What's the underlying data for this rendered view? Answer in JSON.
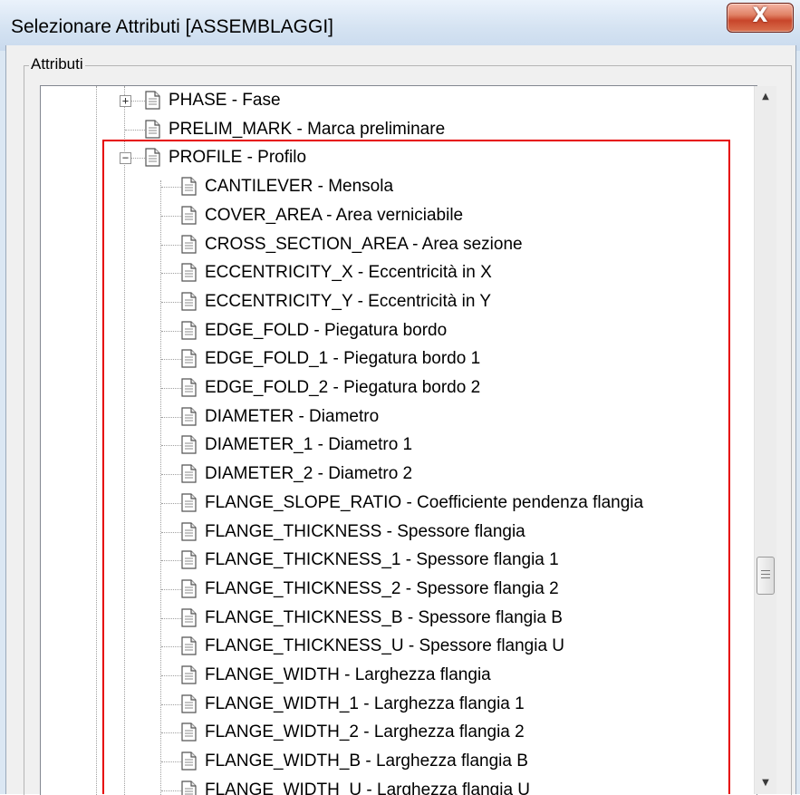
{
  "window": {
    "title": "Selezionare Attributi [ASSEMBLAGGI]",
    "close_icon": "X"
  },
  "group": {
    "label": "Attributi"
  },
  "tree": {
    "items": [
      {
        "text": "PHASE  -  Fase",
        "expander": "+"
      },
      {
        "text": "PRELIM_MARK  -  Marca preliminare",
        "expander": ""
      },
      {
        "text": "PROFILE  -  Profilo",
        "expander": "−"
      }
    ],
    "children": [
      {
        "text": "CANTILEVER  -  Mensola"
      },
      {
        "text": "COVER_AREA  -  Area verniciabile"
      },
      {
        "text": "CROSS_SECTION_AREA  -  Area sezione"
      },
      {
        "text": "ECCENTRICITY_X  -  Eccentricità in X"
      },
      {
        "text": "ECCENTRICITY_Y  -  Eccentricità in Y"
      },
      {
        "text": "EDGE_FOLD  -  Piegatura bordo"
      },
      {
        "text": "EDGE_FOLD_1  -  Piegatura bordo 1"
      },
      {
        "text": "EDGE_FOLD_2  -  Piegatura bordo 2"
      },
      {
        "text": "DIAMETER  -  Diametro"
      },
      {
        "text": "DIAMETER_1  -  Diametro 1"
      },
      {
        "text": "DIAMETER_2  -  Diametro 2"
      },
      {
        "text": "FLANGE_SLOPE_RATIO  -  Coefficiente pendenza flangia"
      },
      {
        "text": "FLANGE_THICKNESS  -  Spessore flangia"
      },
      {
        "text": "FLANGE_THICKNESS_1  -  Spessore flangia 1"
      },
      {
        "text": "FLANGE_THICKNESS_2  -  Spessore flangia 2"
      },
      {
        "text": "FLANGE_THICKNESS_B  -  Spessore flangia B"
      },
      {
        "text": "FLANGE_THICKNESS_U  -  Spessore flangia U"
      },
      {
        "text": "FLANGE_WIDTH  -  Larghezza flangia"
      },
      {
        "text": "FLANGE_WIDTH_1  -  Larghezza flangia 1"
      },
      {
        "text": "FLANGE_WIDTH_2  -  Larghezza flangia 2"
      },
      {
        "text": "FLANGE_WIDTH_B  -  Larghezza flangia B"
      },
      {
        "text": "FLANGE_WIDTH_U  -  Larghezza flangia U"
      }
    ]
  },
  "scrollbar": {
    "up_icon": "▲",
    "down_icon": "▼"
  },
  "colors": {
    "highlight_border": "#e60000",
    "title_bar": "#d5e3f2",
    "close_button": "#c8452a"
  },
  "icons": {
    "document": "document-icon",
    "expand": "plus-box-icon",
    "collapse": "minus-box-icon"
  }
}
